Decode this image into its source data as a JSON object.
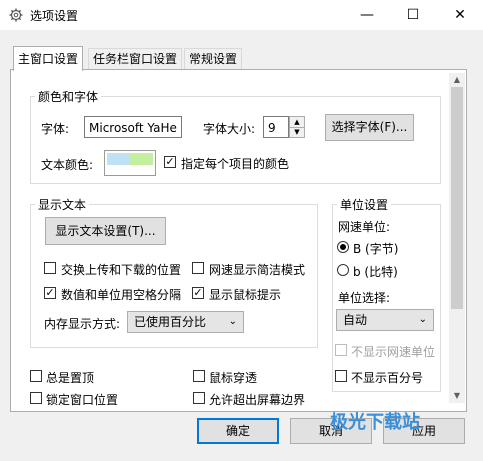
{
  "window": {
    "title": "选项设置",
    "icon": "gear-icon",
    "minimize": "—",
    "maximize": "☐",
    "close": "✕"
  },
  "tabs": [
    {
      "label": "主窗口设置",
      "active": true
    },
    {
      "label": "任务栏窗口设置",
      "active": false
    },
    {
      "label": "常规设置",
      "active": false
    }
  ],
  "color_font": {
    "group_title": "颜色和字体",
    "font_label": "字体:",
    "font_value": "Microsoft YaHe",
    "font_size_label": "字体大小:",
    "font_size_value": "9",
    "choose_font_button": "选择字体(F)...",
    "text_color_label": "文本颜色:",
    "text_color_swatches": [
      "#bfe0f5",
      "#c4eea0"
    ],
    "per_item_color_checkbox": {
      "label": "指定每个项目的颜色",
      "checked": true
    }
  },
  "display_text": {
    "group_title": "显示文本",
    "settings_button": "显示文本设置(T)...",
    "options": [
      {
        "label": "交换上传和下载的位置",
        "checked": false
      },
      {
        "label": "网速显示简洁模式",
        "checked": false
      },
      {
        "label": "数值和单位用空格分隔",
        "checked": true
      },
      {
        "label": "显示鼠标提示",
        "checked": true
      }
    ],
    "memory_label": "内存显示方式:",
    "memory_value": "已使用百分比"
  },
  "units": {
    "group_title": "单位设置",
    "speed_unit_label": "网速单位:",
    "radio_bytes": {
      "label": "B (字节)",
      "selected": true
    },
    "radio_bits": {
      "label": "b (比特)",
      "selected": false
    },
    "unit_select_label": "单位选择:",
    "unit_select_value": "自动",
    "hide_speed_unit": {
      "label": "不显示网速单位",
      "checked": false,
      "disabled": true
    },
    "hide_percent": {
      "label": "不显示百分号",
      "checked": false
    }
  },
  "bottom_options": [
    {
      "label": "总是置顶",
      "checked": false
    },
    {
      "label": "鼠标穿透",
      "checked": false
    },
    {
      "label": "锁定窗口位置",
      "checked": false
    },
    {
      "label": "允许超出屏幕边界",
      "checked": false
    }
  ],
  "footer": {
    "ok": "确定",
    "cancel": "取消",
    "apply": "应用"
  },
  "watermark": "极光下载站"
}
